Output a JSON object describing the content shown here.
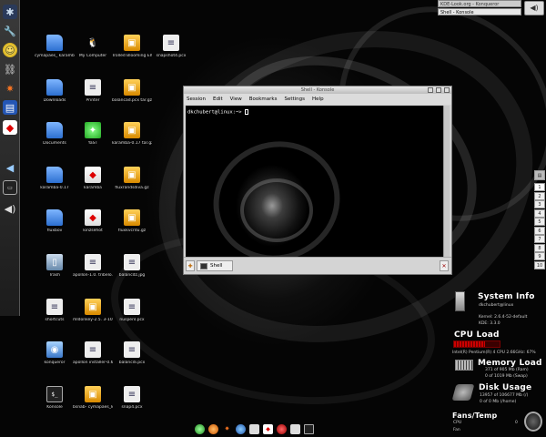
{
  "left_panel": {
    "items": [
      "wrench-icon",
      "smiley-icon",
      "link-icon",
      "star-icon",
      "clapper-icon",
      "game-icon",
      "speaker-icon",
      "terminal-small-icon",
      "sound-icon"
    ]
  },
  "desktop_icons": [
    {
      "label": "cymapaes_ karamba",
      "kind": "folder"
    },
    {
      "label": "My Computer",
      "kind": "tux"
    },
    {
      "label": "Trolled Blooming EW...",
      "kind": "box"
    },
    {
      "label": "snapshot4.pcx",
      "kind": "doc"
    },
    {
      "label": "Downloads",
      "kind": "folder"
    },
    {
      "label": "Printer",
      "kind": "doc"
    },
    {
      "label": "balancad.pcx tar.gz",
      "kind": "box"
    },
    {
      "label": "Documents",
      "kind": "folder"
    },
    {
      "label": "YaST",
      "kind": "grn"
    },
    {
      "label": "karamba-0.17 tar.gz",
      "kind": "box"
    },
    {
      "label": "karamba-0.17",
      "kind": "folder"
    },
    {
      "label": "karamba",
      "kind": "red"
    },
    {
      "label": "fluxrandsdiva.gz",
      "kind": "box"
    },
    {
      "label": "fluxbov",
      "kind": "folder"
    },
    {
      "label": "kinzsehot",
      "kind": "red"
    },
    {
      "label": "fluxkvcrdu.gz",
      "kind": "box"
    },
    {
      "label": "Trash",
      "kind": "trash"
    },
    {
      "label": "apollon-1.0. tribelo.locussin",
      "kind": "doc"
    },
    {
      "label": "balancdz.jpg",
      "kind": "doc"
    },
    {
      "label": "shortcuts",
      "kind": "doc"
    },
    {
      "label": "mldonkey-2.5. 3-100071.9.tar",
      "kind": "box"
    },
    {
      "label": "nuspenl.pcx",
      "kind": "doc"
    },
    {
      "label": "konqueror",
      "kind": "blue"
    },
    {
      "label": "apollon installer-0.6.run",
      "kind": "doc"
    },
    {
      "label": "balancdi.pcx",
      "kind": "doc"
    },
    {
      "label": "Konsole",
      "kind": "term"
    },
    {
      "label": "bsnab- cymapaes_kar...",
      "kind": "box"
    },
    {
      "label": "snap4.pcx",
      "kind": "doc"
    }
  ],
  "taskbar": {
    "tasks": [
      "KDE-Look.org - Konqueror",
      "Shell - Konsole"
    ]
  },
  "konsole": {
    "title": "Shell - Konsole",
    "menu": [
      "Session",
      "Edit",
      "View",
      "Bookmarks",
      "Settings",
      "Help"
    ],
    "prompt": "dkchubert@linux:~> ",
    "tab_label": "Shell"
  },
  "virtual_desktops": [
    "1",
    "2",
    "3",
    "4",
    "5",
    "6",
    "7",
    "8",
    "9",
    "10"
  ],
  "sysinfo": {
    "title": "System Info",
    "user": "dkchubert@linux",
    "kernel": "Kernel: 2.6.4-52-default",
    "kde": "KDE: 3.3.0",
    "cpu_title": "CPU Load",
    "cpu_line": "Intel(R) Pentium(R) 4 CPU 2.66GHz: 67%",
    "cpu_percent": 67,
    "mem_title": "Memory Load",
    "mem_lines": [
      "371     of 905 Mb (Ram)",
      "0       of 1019 Mb (Swap)"
    ],
    "disk_title": "Disk Usage",
    "disk_lines": [
      "13957   of 106677 Mb (/)",
      "0       of 0 Mb (/home)"
    ],
    "fans_title": "Fans/Temp",
    "fans_lines": [
      "CPU",
      "Fan"
    ],
    "fans_value": "0"
  }
}
